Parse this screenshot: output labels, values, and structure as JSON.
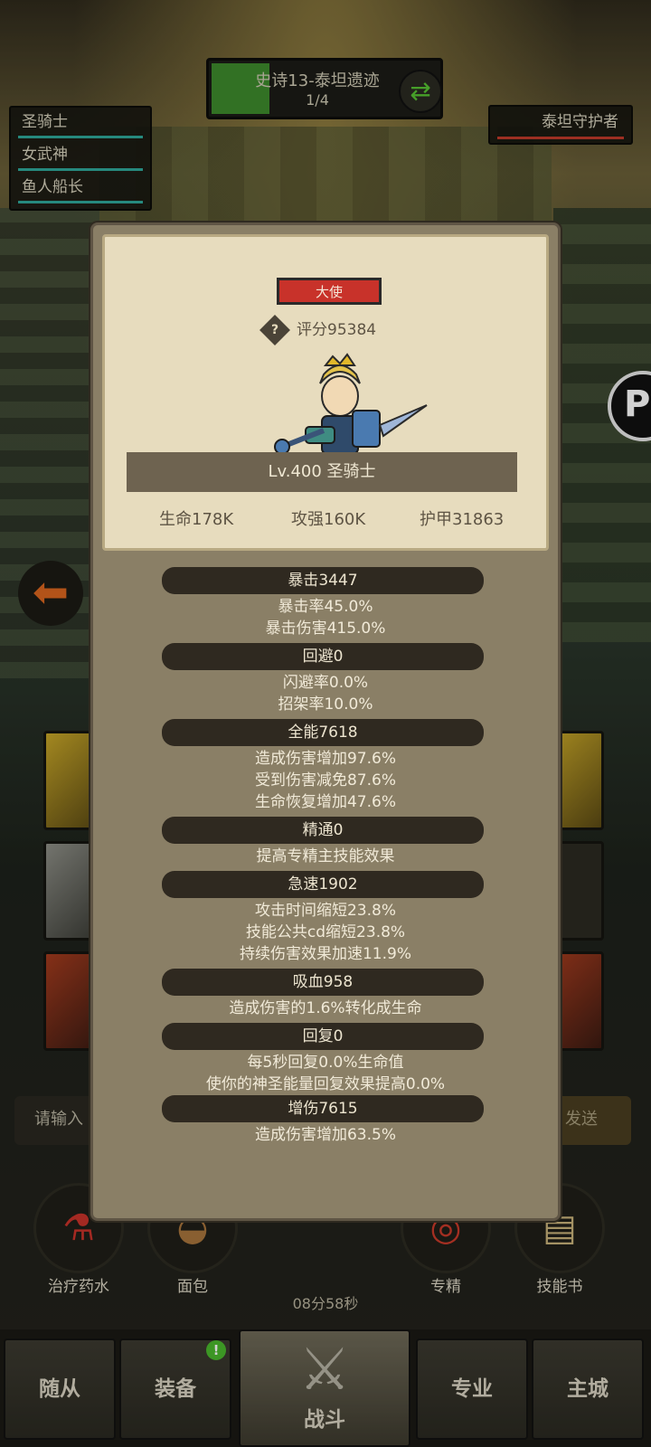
{
  "stage": {
    "title": "史诗13-泰坦遗迹",
    "progress": "1/4",
    "refresh_icon": "refresh-icon"
  },
  "team": [
    {
      "name": "圣骑士"
    },
    {
      "name": "女武神"
    },
    {
      "name": "鱼人船长"
    }
  ],
  "enemy": {
    "name": "泰坦守护者"
  },
  "chat": {
    "placeholder": "请输入",
    "send": "发送"
  },
  "actions": [
    {
      "label": "治疗药水",
      "icon": "potion-icon"
    },
    {
      "label": "面包",
      "icon": "bread-icon"
    },
    {
      "label": "专精",
      "icon": "spec-icon"
    },
    {
      "label": "技能书",
      "icon": "skillbook-icon"
    }
  ],
  "timer": "08分58秒",
  "nav": {
    "tabs": [
      {
        "label": "随从"
      },
      {
        "label": "装备",
        "badge": "!"
      },
      {
        "label": "战斗",
        "active": true
      },
      {
        "label": "专业"
      },
      {
        "label": "主城"
      }
    ]
  },
  "panel": {
    "rank": "大使",
    "score": "评分95384",
    "level_name": "Lv.400 圣骑士",
    "basic": {
      "hp": "生命178K",
      "attack": "攻强160K",
      "armor": "护甲31863"
    },
    "stats": [
      {
        "head": "暴击3447",
        "lines": [
          "暴击率45.0%",
          "暴击伤害415.0%"
        ]
      },
      {
        "head": "回避0",
        "lines": [
          "闪避率0.0%",
          "招架率10.0%"
        ]
      },
      {
        "head": "全能7618",
        "lines": [
          "造成伤害增加97.6%",
          "受到伤害减免87.6%",
          "生命恢复增加47.6%"
        ]
      },
      {
        "head": "精通0",
        "lines": [
          "提高专精主技能效果"
        ]
      },
      {
        "head": "急速1902",
        "lines": [
          "攻击时间缩短23.8%",
          "技能公共cd缩短23.8%",
          "持续伤害效果加速11.9%"
        ]
      },
      {
        "head": "吸血958",
        "lines": [
          "造成伤害的1.6%转化成生命"
        ]
      },
      {
        "head": "回复0",
        "lines": [
          "每5秒回复0.0%生命值",
          "使你的神圣能量回复效果提高0.0%"
        ]
      },
      {
        "head": "增伤7615",
        "lines": [
          "造成伤害增加63.5%"
        ]
      }
    ]
  },
  "colors": {
    "rank_red": "#c8322a",
    "panel_bg": "#8a7f66",
    "card_bg": "#e7dcbe",
    "stage_green": "#3d8a2c"
  }
}
